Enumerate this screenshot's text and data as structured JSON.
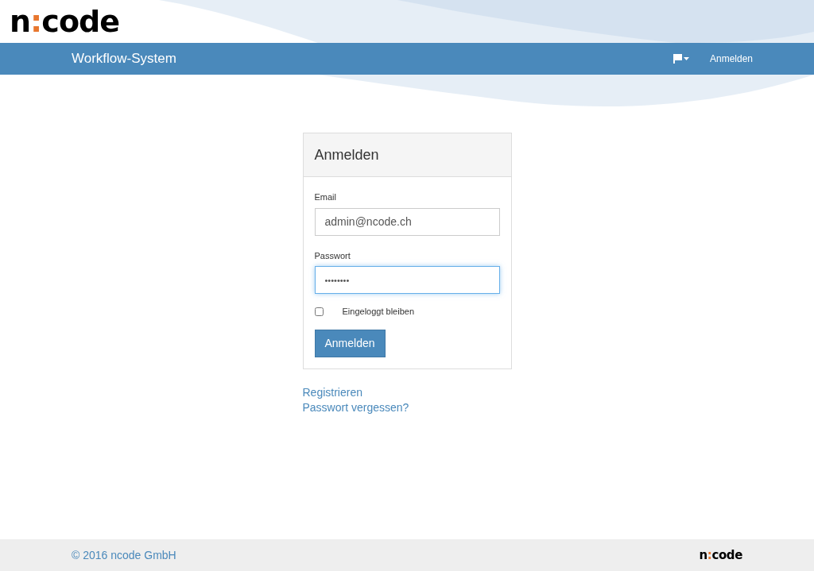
{
  "logo": {
    "prefix": "n",
    "separator": ":",
    "suffix": "code"
  },
  "navbar": {
    "brand": "Workflow-System",
    "login_link": "Anmelden"
  },
  "login_panel": {
    "title": "Anmelden",
    "email": {
      "label": "Email",
      "value": "admin@ncode.ch"
    },
    "password": {
      "label": "Passwort",
      "value": "••••••••",
      "focused": true
    },
    "remember": {
      "label": "Eingeloggt bleiben",
      "checked": false
    },
    "submit": "Anmelden"
  },
  "links": [
    "Registrieren",
    "Passwort vergessen?"
  ],
  "footer": {
    "copyright": "© 2016 ncode GmbH",
    "logo": {
      "prefix": "n",
      "separator": ":",
      "suffix": "code"
    }
  }
}
